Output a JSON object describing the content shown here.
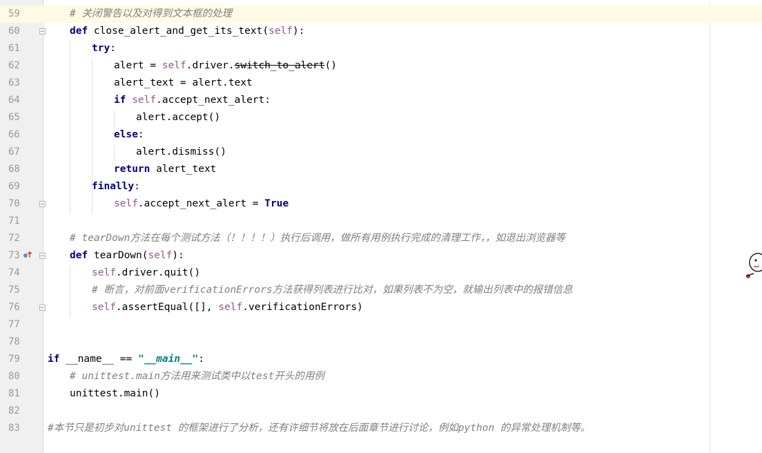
{
  "editor": {
    "current_line_index": 0,
    "lines": [
      {
        "num": "59",
        "indent": 1,
        "tokens": [
          {
            "t": "# 关闭警告以及对得到文本框的处理",
            "c": "cm"
          }
        ]
      },
      {
        "num": "60",
        "indent": 1,
        "tokens": [
          {
            "t": "def ",
            "c": "kw"
          },
          {
            "t": "close_alert_and_get_its_text(",
            "c": ""
          },
          {
            "t": "self",
            "c": "self"
          },
          {
            "t": "):",
            "c": ""
          }
        ]
      },
      {
        "num": "61",
        "indent": 2,
        "tokens": [
          {
            "t": "try",
            "c": "kw"
          },
          {
            "t": ":",
            "c": ""
          }
        ]
      },
      {
        "num": "62",
        "indent": 3,
        "tokens": [
          {
            "t": "alert = ",
            "c": ""
          },
          {
            "t": "self",
            "c": "self"
          },
          {
            "t": ".driver.",
            "c": ""
          },
          {
            "t": "switch_to_alert",
            "c": "strike"
          },
          {
            "t": "()",
            "c": ""
          }
        ]
      },
      {
        "num": "63",
        "indent": 3,
        "tokens": [
          {
            "t": "alert_text = alert.text",
            "c": ""
          }
        ]
      },
      {
        "num": "64",
        "indent": 3,
        "tokens": [
          {
            "t": "if ",
            "c": "kw"
          },
          {
            "t": "self",
            "c": "self"
          },
          {
            "t": ".accept_next_alert:",
            "c": ""
          }
        ]
      },
      {
        "num": "65",
        "indent": 4,
        "tokens": [
          {
            "t": "alert.accept()",
            "c": ""
          }
        ]
      },
      {
        "num": "66",
        "indent": 3,
        "tokens": [
          {
            "t": "else",
            "c": "kw"
          },
          {
            "t": ":",
            "c": ""
          }
        ]
      },
      {
        "num": "67",
        "indent": 4,
        "tokens": [
          {
            "t": "alert.dismiss()",
            "c": ""
          }
        ]
      },
      {
        "num": "68",
        "indent": 3,
        "tokens": [
          {
            "t": "return ",
            "c": "kw"
          },
          {
            "t": "alert_text",
            "c": ""
          }
        ]
      },
      {
        "num": "69",
        "indent": 2,
        "tokens": [
          {
            "t": "finally",
            "c": "kw"
          },
          {
            "t": ":",
            "c": ""
          }
        ]
      },
      {
        "num": "70",
        "indent": 3,
        "tokens": [
          {
            "t": "self",
            "c": "self"
          },
          {
            "t": ".accept_next_alert = ",
            "c": ""
          },
          {
            "t": "True",
            "c": "kw"
          }
        ]
      },
      {
        "num": "71",
        "indent": 0,
        "tokens": []
      },
      {
        "num": "72",
        "indent": 1,
        "tokens": [
          {
            "t": "# tearDown方法在每个测试方法（！！！！）执行后调用，做所有用例执行完成的清理工作，，如退出浏览器等",
            "c": "cm"
          }
        ]
      },
      {
        "num": "73",
        "indent": 1,
        "tokens": [
          {
            "t": "def ",
            "c": "kw"
          },
          {
            "t": "tearDown(",
            "c": ""
          },
          {
            "t": "self",
            "c": "self"
          },
          {
            "t": "):",
            "c": ""
          }
        ]
      },
      {
        "num": "74",
        "indent": 2,
        "tokens": [
          {
            "t": "self",
            "c": "self"
          },
          {
            "t": ".driver.quit()",
            "c": ""
          }
        ]
      },
      {
        "num": "75",
        "indent": 2,
        "tokens": [
          {
            "t": "# 断言，对前面verificationErrors方法获得列表进行比对，如果列表不为空，就输出列表中的报错信息",
            "c": "cm"
          }
        ]
      },
      {
        "num": "76",
        "indent": 2,
        "tokens": [
          {
            "t": "self",
            "c": "self"
          },
          {
            "t": ".assertEqual([], ",
            "c": ""
          },
          {
            "t": "self",
            "c": "self"
          },
          {
            "t": ".verificationErrors)",
            "c": ""
          }
        ]
      },
      {
        "num": "77",
        "indent": 0,
        "tokens": []
      },
      {
        "num": "78",
        "indent": 0,
        "tokens": []
      },
      {
        "num": "79",
        "indent": 0,
        "tokens": [
          {
            "t": "if ",
            "c": "kw"
          },
          {
            "t": "__name__ == ",
            "c": ""
          },
          {
            "t": "\"__main__\"",
            "c": "str"
          },
          {
            "t": ":",
            "c": ""
          }
        ]
      },
      {
        "num": "80",
        "indent": 1,
        "tokens": [
          {
            "t": "# unittest.main方法用来测试类中以test开头的用例",
            "c": "cm"
          }
        ]
      },
      {
        "num": "81",
        "indent": 1,
        "tokens": [
          {
            "t": "unittest.main()",
            "c": ""
          }
        ]
      },
      {
        "num": "82",
        "indent": 0,
        "tokens": []
      },
      {
        "num": "83",
        "indent": 0,
        "tokens": [
          {
            "t": "#本节只是初步对unittest 的框架进行了分析，还有许细节将放在后面章节进行讨论，例如python 的异常处理机制等。",
            "c": "cm"
          }
        ]
      }
    ]
  },
  "icons": {
    "override": "override-up-arrow-icon",
    "fold": "fold-marker-icon",
    "mascot": "mascot-sticker-icon"
  },
  "colors": {
    "keyword": "#000080",
    "self": "#94558d",
    "comment": "#808080",
    "string": "#008080",
    "current_line": "#fffae3",
    "gutter": "#f0f0f0"
  }
}
